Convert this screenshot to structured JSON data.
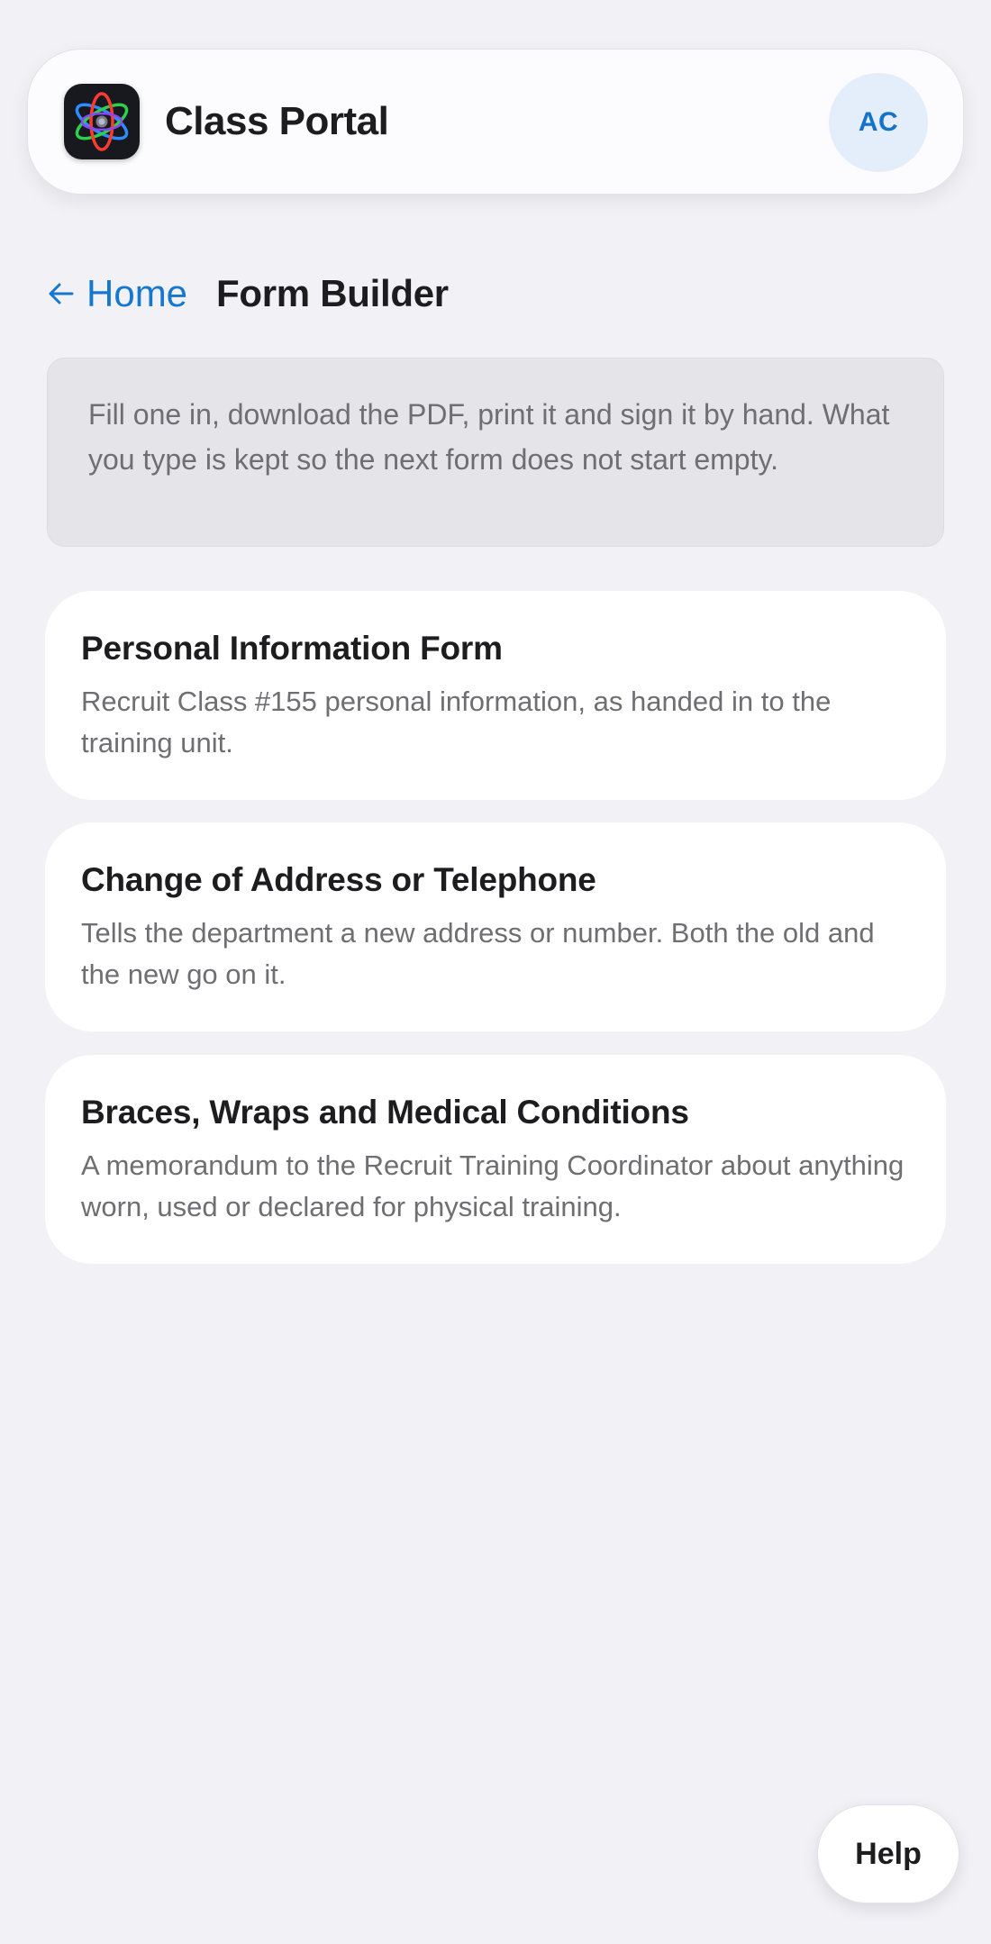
{
  "header": {
    "app_icon": "atom-icon",
    "title": "Class Portal",
    "avatar_initials": "AC"
  },
  "breadcrumb": {
    "back_icon": "arrow-left-icon",
    "back_label": "Home",
    "current": "Form Builder"
  },
  "notice": {
    "text": "Fill one in, download the PDF, print it and sign it by hand. What you type is kept so the next form does not start empty."
  },
  "forms": [
    {
      "title": "Personal Information Form",
      "description": "Recruit Class #155 personal information, as handed in to the training unit."
    },
    {
      "title": "Change of Address or Telephone",
      "description": "Tells the department a new address or number. Both the old and the new go on it."
    },
    {
      "title": "Braces, Wraps and Medical Conditions",
      "description": "A memorandum to the Recruit Training Coordinator about anything worn, used or declared for physical training."
    }
  ],
  "help": {
    "label": "Help"
  },
  "colors": {
    "background": "#f1f1f6",
    "accent": "#1677cf",
    "avatar_bg": "#e4eefb",
    "text_primary": "#1d1d1f",
    "text_secondary": "#6e6e73",
    "notice_bg": "#e4e4e9",
    "app_icon_bg": "#18181f"
  }
}
